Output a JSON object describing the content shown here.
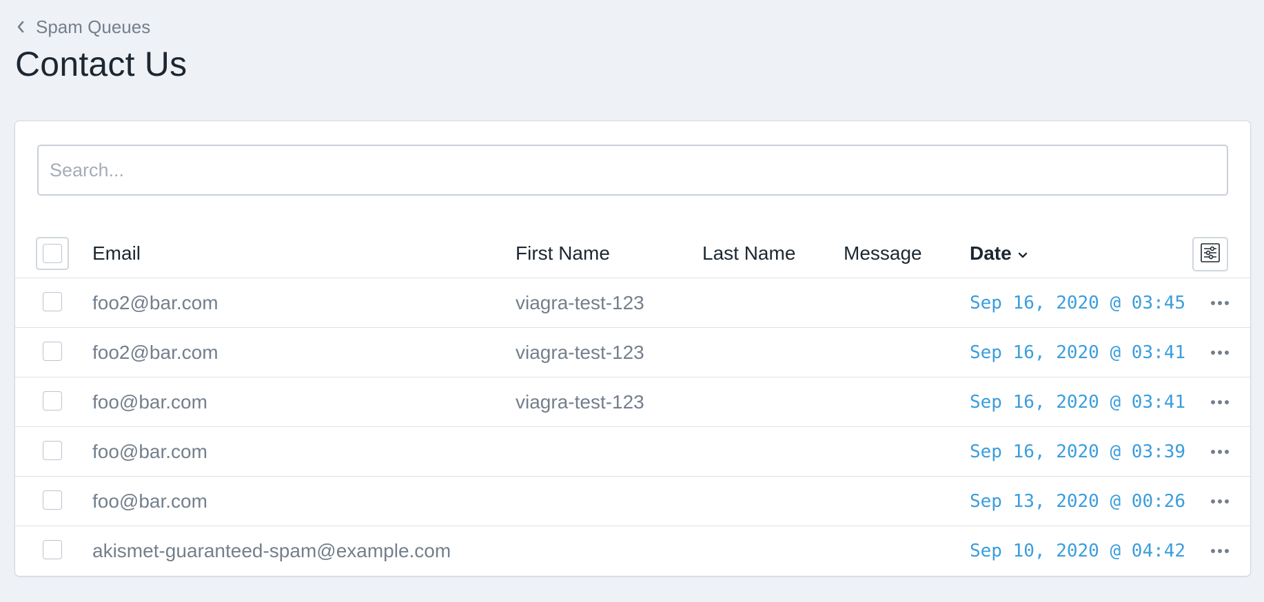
{
  "breadcrumb": {
    "label": "Spam Queues"
  },
  "page": {
    "title": "Contact Us"
  },
  "search": {
    "placeholder": "Search...",
    "value": ""
  },
  "table": {
    "columns": {
      "email": "Email",
      "first_name": "First Name",
      "last_name": "Last Name",
      "message": "Message",
      "date": "Date"
    },
    "sort": {
      "column": "date",
      "direction": "desc"
    },
    "rows": [
      {
        "email": "foo2@bar.com",
        "first_name": "viagra-test-123",
        "last_name": "",
        "message": "",
        "date": "Sep 16, 2020 @ 03:45"
      },
      {
        "email": "foo2@bar.com",
        "first_name": "viagra-test-123",
        "last_name": "",
        "message": "",
        "date": "Sep 16, 2020 @ 03:41"
      },
      {
        "email": "foo@bar.com",
        "first_name": "viagra-test-123",
        "last_name": "",
        "message": "",
        "date": "Sep 16, 2020 @ 03:41"
      },
      {
        "email": "foo@bar.com",
        "first_name": "",
        "last_name": "",
        "message": "",
        "date": "Sep 16, 2020 @ 03:39"
      },
      {
        "email": "foo@bar.com",
        "first_name": "",
        "last_name": "",
        "message": "",
        "date": "Sep 13, 2020 @ 00:26"
      },
      {
        "email": "akismet-guaranteed-spam@example.com",
        "first_name": "",
        "last_name": "",
        "message": "",
        "date": "Sep 10, 2020 @ 04:42"
      }
    ]
  },
  "icons": {
    "breadcrumb": "chevron-left-icon",
    "sort": "chevron-down-icon",
    "column_settings": "sliders-icon",
    "row_actions": "ellipsis-icon"
  },
  "colors": {
    "background": "#eef1f6",
    "card": "#ffffff",
    "link": "#3a9ddc",
    "muted_text": "#737f8c",
    "heading_text": "#1c2731",
    "border": "#dde2e8"
  }
}
